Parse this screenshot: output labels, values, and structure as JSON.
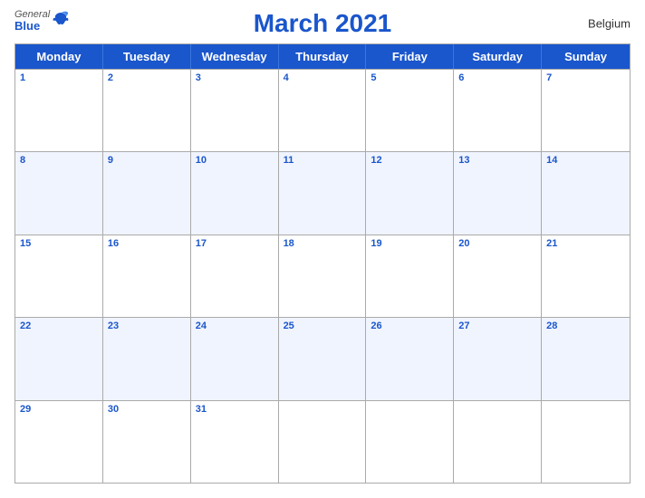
{
  "header": {
    "title": "March 2021",
    "country": "Belgium",
    "logo_general": "General",
    "logo_blue": "Blue"
  },
  "days_of_week": [
    "Monday",
    "Tuesday",
    "Wednesday",
    "Thursday",
    "Friday",
    "Saturday",
    "Sunday"
  ],
  "weeks": [
    [
      {
        "date": "1",
        "empty": false
      },
      {
        "date": "2",
        "empty": false
      },
      {
        "date": "3",
        "empty": false
      },
      {
        "date": "4",
        "empty": false
      },
      {
        "date": "5",
        "empty": false
      },
      {
        "date": "6",
        "empty": false
      },
      {
        "date": "7",
        "empty": false
      }
    ],
    [
      {
        "date": "8",
        "empty": false
      },
      {
        "date": "9",
        "empty": false
      },
      {
        "date": "10",
        "empty": false
      },
      {
        "date": "11",
        "empty": false
      },
      {
        "date": "12",
        "empty": false
      },
      {
        "date": "13",
        "empty": false
      },
      {
        "date": "14",
        "empty": false
      }
    ],
    [
      {
        "date": "15",
        "empty": false
      },
      {
        "date": "16",
        "empty": false
      },
      {
        "date": "17",
        "empty": false
      },
      {
        "date": "18",
        "empty": false
      },
      {
        "date": "19",
        "empty": false
      },
      {
        "date": "20",
        "empty": false
      },
      {
        "date": "21",
        "empty": false
      }
    ],
    [
      {
        "date": "22",
        "empty": false
      },
      {
        "date": "23",
        "empty": false
      },
      {
        "date": "24",
        "empty": false
      },
      {
        "date": "25",
        "empty": false
      },
      {
        "date": "26",
        "empty": false
      },
      {
        "date": "27",
        "empty": false
      },
      {
        "date": "28",
        "empty": false
      }
    ],
    [
      {
        "date": "29",
        "empty": false
      },
      {
        "date": "30",
        "empty": false
      },
      {
        "date": "31",
        "empty": false
      },
      {
        "date": "",
        "empty": true
      },
      {
        "date": "",
        "empty": true
      },
      {
        "date": "",
        "empty": true
      },
      {
        "date": "",
        "empty": true
      }
    ]
  ]
}
